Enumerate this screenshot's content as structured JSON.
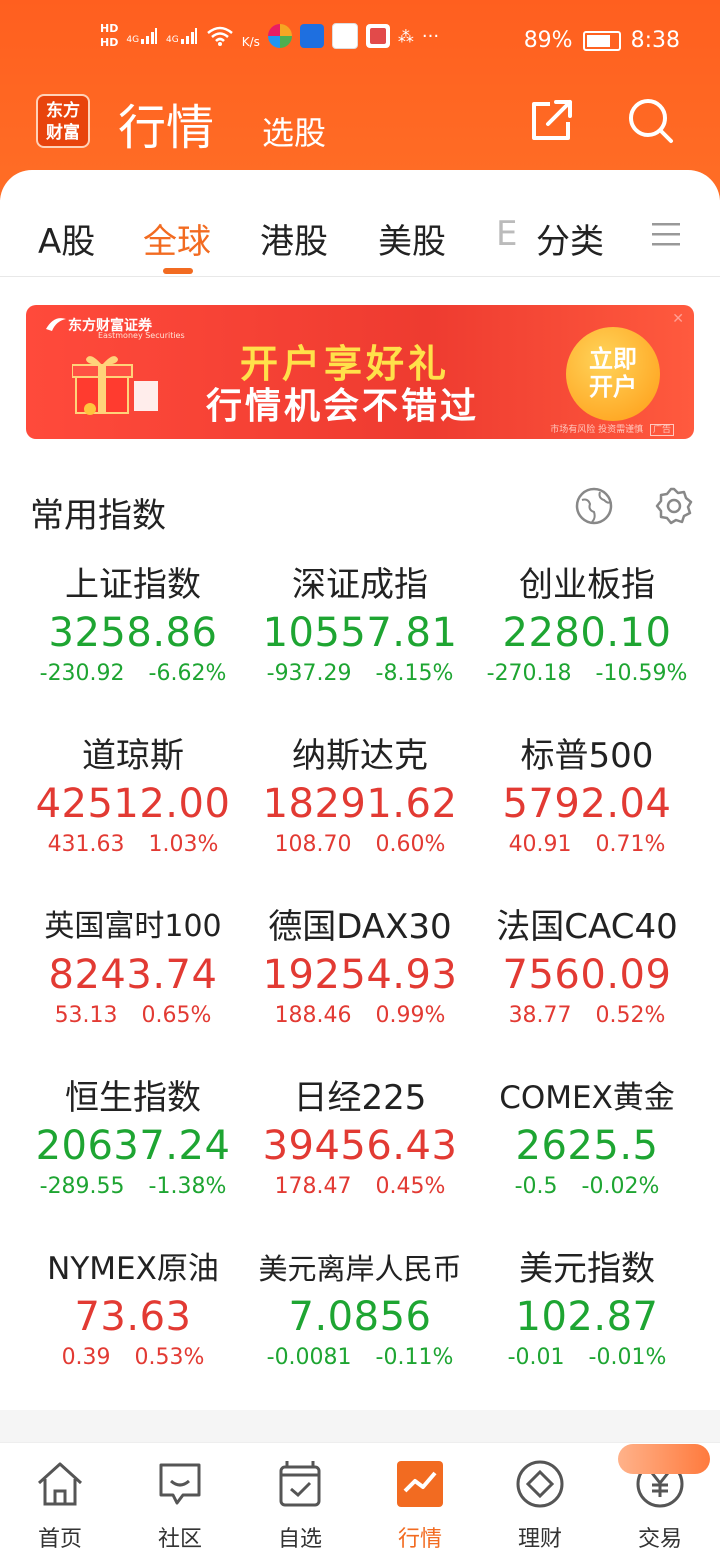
{
  "status": {
    "hd1": "HD",
    "hd2": "HD",
    "sig1": "4G",
    "sig2": "4G",
    "speed": "K/s",
    "more": "···",
    "battery_pct": "89%",
    "battery_level": 0.89,
    "time": "8:38"
  },
  "header": {
    "logo_line1": "东方",
    "logo_line2": "财富",
    "title": "行情",
    "subtitle": "选股",
    "share_icon": "share-icon",
    "search_icon": "search-icon"
  },
  "tabs": [
    {
      "label": "A股"
    },
    {
      "label": "全球"
    },
    {
      "label": "港股"
    },
    {
      "label": "美股"
    },
    {
      "label": "E"
    },
    {
      "label": "分类"
    }
  ],
  "active_tab": "全球",
  "banner": {
    "brand": "东方财富证券",
    "brand_en": "Eastmoney Securities",
    "line1": "开户享好礼",
    "line2": "行情机会不错过",
    "cta_line1": "立即",
    "cta_line2": "开户",
    "disclaimer": "市场有风险 投资需谨慎",
    "ad_tag": "广告"
  },
  "section": {
    "title": "常用指数"
  },
  "indices": [
    {
      "name": "上证指数",
      "value": "3258.86",
      "change": "-230.92",
      "pct": "-6.62%",
      "trend": "down"
    },
    {
      "name": "深证成指",
      "value": "10557.81",
      "change": "-937.29",
      "pct": "-8.15%",
      "trend": "down"
    },
    {
      "name": "创业板指",
      "value": "2280.10",
      "change": "-270.18",
      "pct": "-10.59%",
      "trend": "down"
    },
    {
      "name": "道琼斯",
      "value": "42512.00",
      "change": "431.63",
      "pct": "1.03%",
      "trend": "up"
    },
    {
      "name": "纳斯达克",
      "value": "18291.62",
      "change": "108.70",
      "pct": "0.60%",
      "trend": "up"
    },
    {
      "name": "标普500",
      "value": "5792.04",
      "change": "40.91",
      "pct": "0.71%",
      "trend": "up"
    },
    {
      "name": "英国富时100",
      "value": "8243.74",
      "change": "53.13",
      "pct": "0.65%",
      "trend": "up"
    },
    {
      "name": "德国DAX30",
      "value": "19254.93",
      "change": "188.46",
      "pct": "0.99%",
      "trend": "up"
    },
    {
      "name": "法国CAC40",
      "value": "7560.09",
      "change": "38.77",
      "pct": "0.52%",
      "trend": "up"
    },
    {
      "name": "恒生指数",
      "value": "20637.24",
      "change": "-289.55",
      "pct": "-1.38%",
      "trend": "down"
    },
    {
      "name": "日经225",
      "value": "39456.43",
      "change": "178.47",
      "pct": "0.45%",
      "trend": "up"
    },
    {
      "name": "COMEX黄金",
      "value": "2625.5",
      "change": "-0.5",
      "pct": "-0.02%",
      "trend": "down"
    },
    {
      "name": "NYMEX原油",
      "value": "73.63",
      "change": "0.39",
      "pct": "0.53%",
      "trend": "up"
    },
    {
      "name": "美元离岸人民币",
      "value": "7.0856",
      "change": "-0.0081",
      "pct": "-0.11%",
      "trend": "down"
    },
    {
      "name": "美元指数",
      "value": "102.87",
      "change": "-0.01",
      "pct": "-0.01%",
      "trend": "down"
    }
  ],
  "nav": [
    {
      "label": "首页",
      "icon": "home-icon"
    },
    {
      "label": "社区",
      "icon": "chat-icon"
    },
    {
      "label": "自选",
      "icon": "checklist-icon"
    },
    {
      "label": "行情",
      "icon": "chart-icon"
    },
    {
      "label": "理财",
      "icon": "diamond-icon"
    },
    {
      "label": "交易",
      "icon": "yuan-icon"
    }
  ],
  "colors": {
    "brand": "#ff6a22",
    "accent": "#f26b21",
    "up": "#e23a33",
    "down": "#1ea532"
  }
}
